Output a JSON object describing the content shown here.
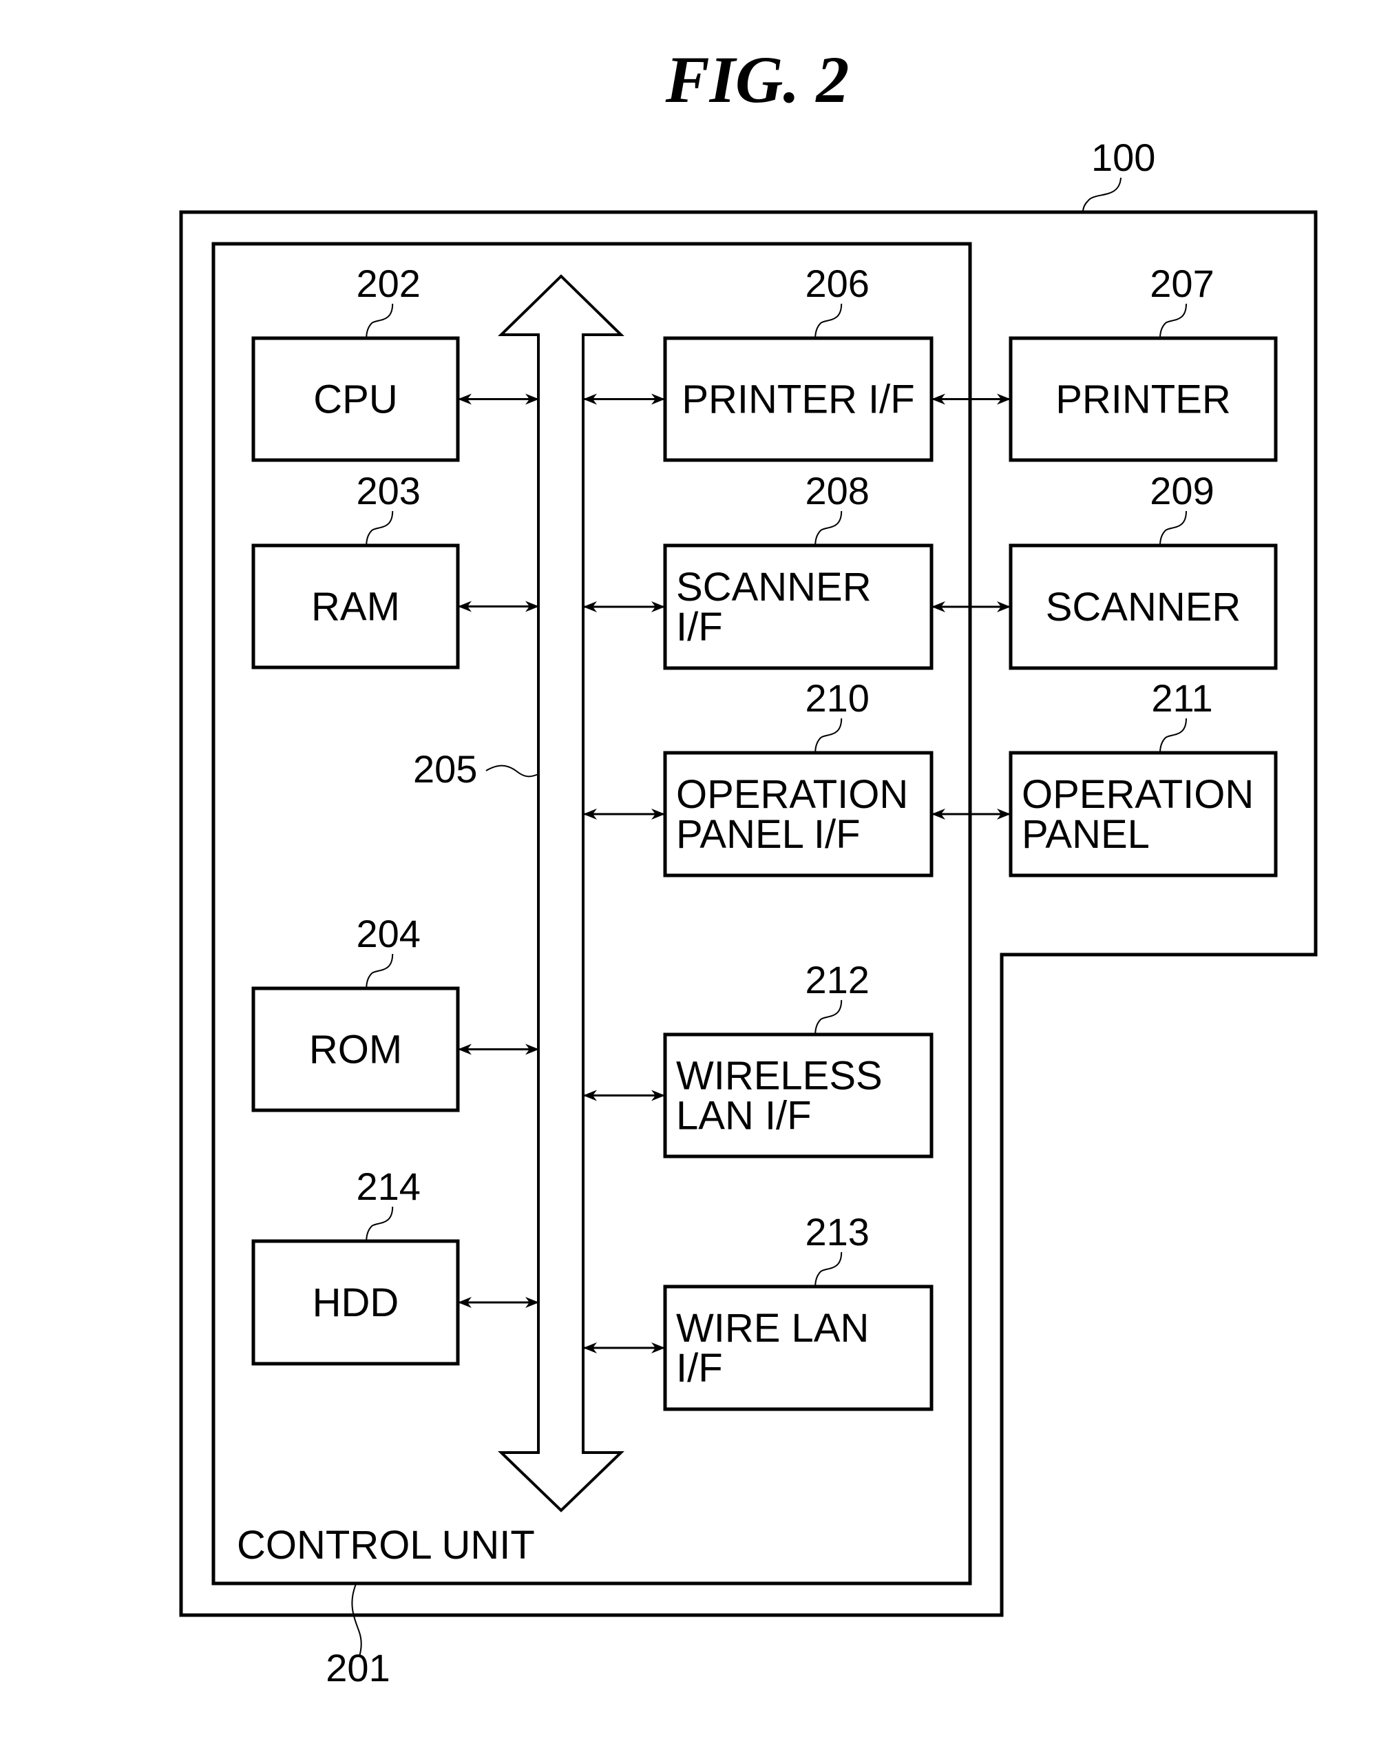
{
  "figure": {
    "title": "FIG. 2",
    "apparatus_ref": "100",
    "control_unit": {
      "label": "CONTROL UNIT",
      "ref": "201"
    },
    "bus": {
      "ref": "205"
    },
    "left_blocks": [
      {
        "id": "cpu",
        "label": [
          "CPU"
        ],
        "ref": "202"
      },
      {
        "id": "ram",
        "label": [
          "RAM"
        ],
        "ref": "203"
      },
      {
        "id": "rom",
        "label": [
          "ROM"
        ],
        "ref": "204"
      },
      {
        "id": "hdd",
        "label": [
          "HDD"
        ],
        "ref": "214"
      }
    ],
    "interface_blocks": [
      {
        "id": "printer-if",
        "label": [
          "PRINTER I/F"
        ],
        "ref": "206"
      },
      {
        "id": "scanner-if",
        "label": [
          "SCANNER",
          "I/F"
        ],
        "ref": "208"
      },
      {
        "id": "operation-panel-if",
        "label": [
          "OPERATION",
          "PANEL I/F"
        ],
        "ref": "210"
      },
      {
        "id": "wireless-lan-if",
        "label": [
          "WIRELESS",
          "LAN I/F"
        ],
        "ref": "212"
      },
      {
        "id": "wire-lan-if",
        "label": [
          "WIRE LAN",
          "I/F"
        ],
        "ref": "213"
      }
    ],
    "device_blocks": [
      {
        "id": "printer",
        "label": [
          "PRINTER"
        ],
        "ref": "207"
      },
      {
        "id": "scanner",
        "label": [
          "SCANNER"
        ],
        "ref": "209"
      },
      {
        "id": "operation-panel",
        "label": [
          "OPERATION",
          "PANEL"
        ],
        "ref": "211"
      }
    ]
  }
}
